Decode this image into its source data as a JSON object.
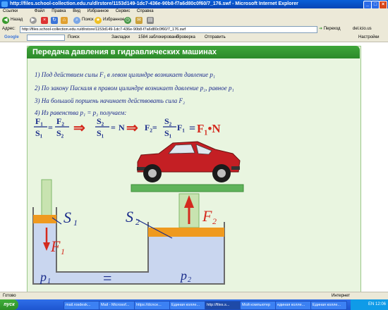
{
  "window": {
    "title": "http://files.school-collection.edu.ru/dlrstore/1153d149-1dc7-436e-90b8-f7a6d80c0f60/7_176.swf - Microsoft Internet Explorer",
    "minimize": "_",
    "maximize": "□",
    "close": "×"
  },
  "menubar": {
    "links": "Ссылки",
    "items": [
      "Файл",
      "Правка",
      "Вид",
      "Избранное",
      "Сервис",
      "Справка"
    ]
  },
  "toolbar": {
    "back": "Назад",
    "search": "Поиск",
    "favorites": "Избранное"
  },
  "address": {
    "label": "Адрес:",
    "url": "http://files.school-collection.edu.ru/dlrstore/1153d149-1dc7-436e-90b8-f7a6d80c0f60/7_176.swf",
    "go": "Переход",
    "extra": "del.icio.us"
  },
  "googlebar": {
    "brand": "Google",
    "go": "Поиск",
    "bookmarks": "Закладки",
    "blocked": "1584 заблокировано",
    "check": "Проверка",
    "send": "Отправить",
    "settings": "Настройки"
  },
  "slide": {
    "title": "Передача давления в гидравлических машинах",
    "statements": [
      "1) Под действием силы F₁ в левом цилиндре возникает давление p₁",
      "2) По закону Паскаля в правом цилиндре возникает давление p₂, равное p₁",
      "3) На большой поршень начинает действовать сила F₂",
      "4) Из равенства p₁ = p₂ получаем:"
    ],
    "formula": {
      "f1": "F₁",
      "s1": "S₁",
      "f2": "F₂",
      "s2": "S₂",
      "eq": "=",
      "n": "N",
      "arrow": "⇒",
      "f2eq": "F₂=",
      "f1times": "F₁",
      "result": "F₁•N"
    },
    "labels": {
      "s1": "S",
      "s1sub": "1",
      "s2": "S",
      "s2sub": "2",
      "f1": "F",
      "f1sub": "1",
      "f2": "F",
      "f2sub": "2",
      "p1": "p",
      "p1sub": "1",
      "p2": "p",
      "p2sub": "2",
      "equal": "="
    }
  },
  "statusbar": {
    "text": "Готово",
    "zone": "Интернет"
  },
  "taskbar": {
    "start": "пуск",
    "tasks": [
      "mail.rosdesk...",
      "Mail - Microsof...",
      "https://dcnce...",
      "Единая колле...",
      "http://files.s...",
      "Мой компьютер",
      "единая колле...",
      "Единая колле..."
    ],
    "clock": "12:06",
    "lang": "EN"
  },
  "colors": {
    "accent": "#2c8a2a",
    "text": "#1c2a8c",
    "force": "#d42a1e",
    "liquid": "#c9d6ef",
    "piston": "#ef9a1f"
  }
}
